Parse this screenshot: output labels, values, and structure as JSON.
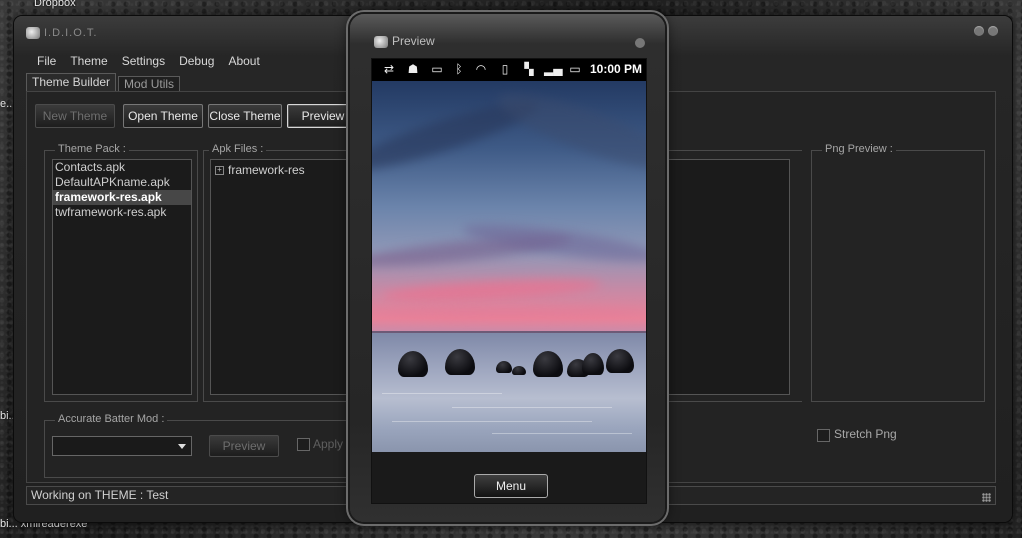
{
  "desktop": {
    "top_label": "Dropbox",
    "left_label_1": "e...",
    "left_label_2": "bi...",
    "taskbar_label": "bi...  xmlreaderexe"
  },
  "main_window": {
    "title": "I.D.I.O.T.",
    "menu": [
      "File",
      "Theme",
      "Settings",
      "Debug",
      "About"
    ],
    "tabs": [
      "Theme Builder",
      "Mod Utils"
    ],
    "buttons": {
      "new_theme": "New Theme",
      "open_theme": "Open Theme",
      "close_theme": "Close Theme",
      "preview": "Preview"
    },
    "theme_pack": {
      "label": "Theme Pack :",
      "items": [
        "Contacts.apk",
        "DefaultAPKname.apk",
        "framework-res.apk",
        "twframework-res.apk"
      ],
      "selected": "framework-res.apk"
    },
    "apk_files": {
      "label": "Apk Files :",
      "tree_items": [
        "framework-res"
      ]
    },
    "png_preview": {
      "label": "Png Preview :",
      "stretch_label": "Stretch Png"
    },
    "battery_mod": {
      "label": "Accurate Batter Mod :",
      "preview_button": "Preview",
      "apply_label": "Apply Ba"
    },
    "status": "Working on THEME : Test"
  },
  "preview_window": {
    "title": "Preview",
    "status_bar": {
      "icons": [
        "usb-icon",
        "android-icon",
        "message-icon",
        "bluetooth-icon",
        "wifi-icon",
        "vibrate-icon",
        "network-icon",
        "signal-icon",
        "battery-icon"
      ],
      "time": "10:00 PM"
    },
    "menu_button": "Menu"
  }
}
